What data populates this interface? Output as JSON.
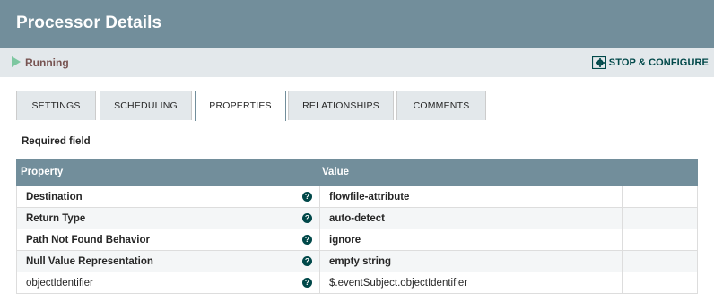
{
  "header": {
    "title": "Processor Details"
  },
  "status": {
    "state": "Running",
    "stop_configure_label": "STOP & CONFIGURE"
  },
  "tabs": [
    {
      "label": "SETTINGS",
      "active": false
    },
    {
      "label": "SCHEDULING",
      "active": false
    },
    {
      "label": "PROPERTIES",
      "active": true
    },
    {
      "label": "RELATIONSHIPS",
      "active": false
    },
    {
      "label": "COMMENTS",
      "active": false
    }
  ],
  "required_note": "Required field",
  "grid": {
    "col_property": "Property",
    "col_value": "Value",
    "rows": [
      {
        "property": "Destination",
        "value": "flowfile-attribute",
        "required": true
      },
      {
        "property": "Return Type",
        "value": "auto-detect",
        "required": true
      },
      {
        "property": "Path Not Found Behavior",
        "value": "ignore",
        "required": true
      },
      {
        "property": "Null Value Representation",
        "value": "empty string",
        "required": true
      },
      {
        "property": "objectIdentifier",
        "value": "$.eventSubject.objectIdentifier",
        "required": false
      }
    ],
    "help_glyph": "?"
  },
  "colors": {
    "header_bg": "#728e9b",
    "status_bg": "#e3e8eb",
    "running_icon": "#7dc7a0",
    "running_text": "#775351",
    "accent": "#004849"
  },
  "icons": {
    "status": "play-icon",
    "configure": "gear-icon",
    "help": "help-icon"
  }
}
